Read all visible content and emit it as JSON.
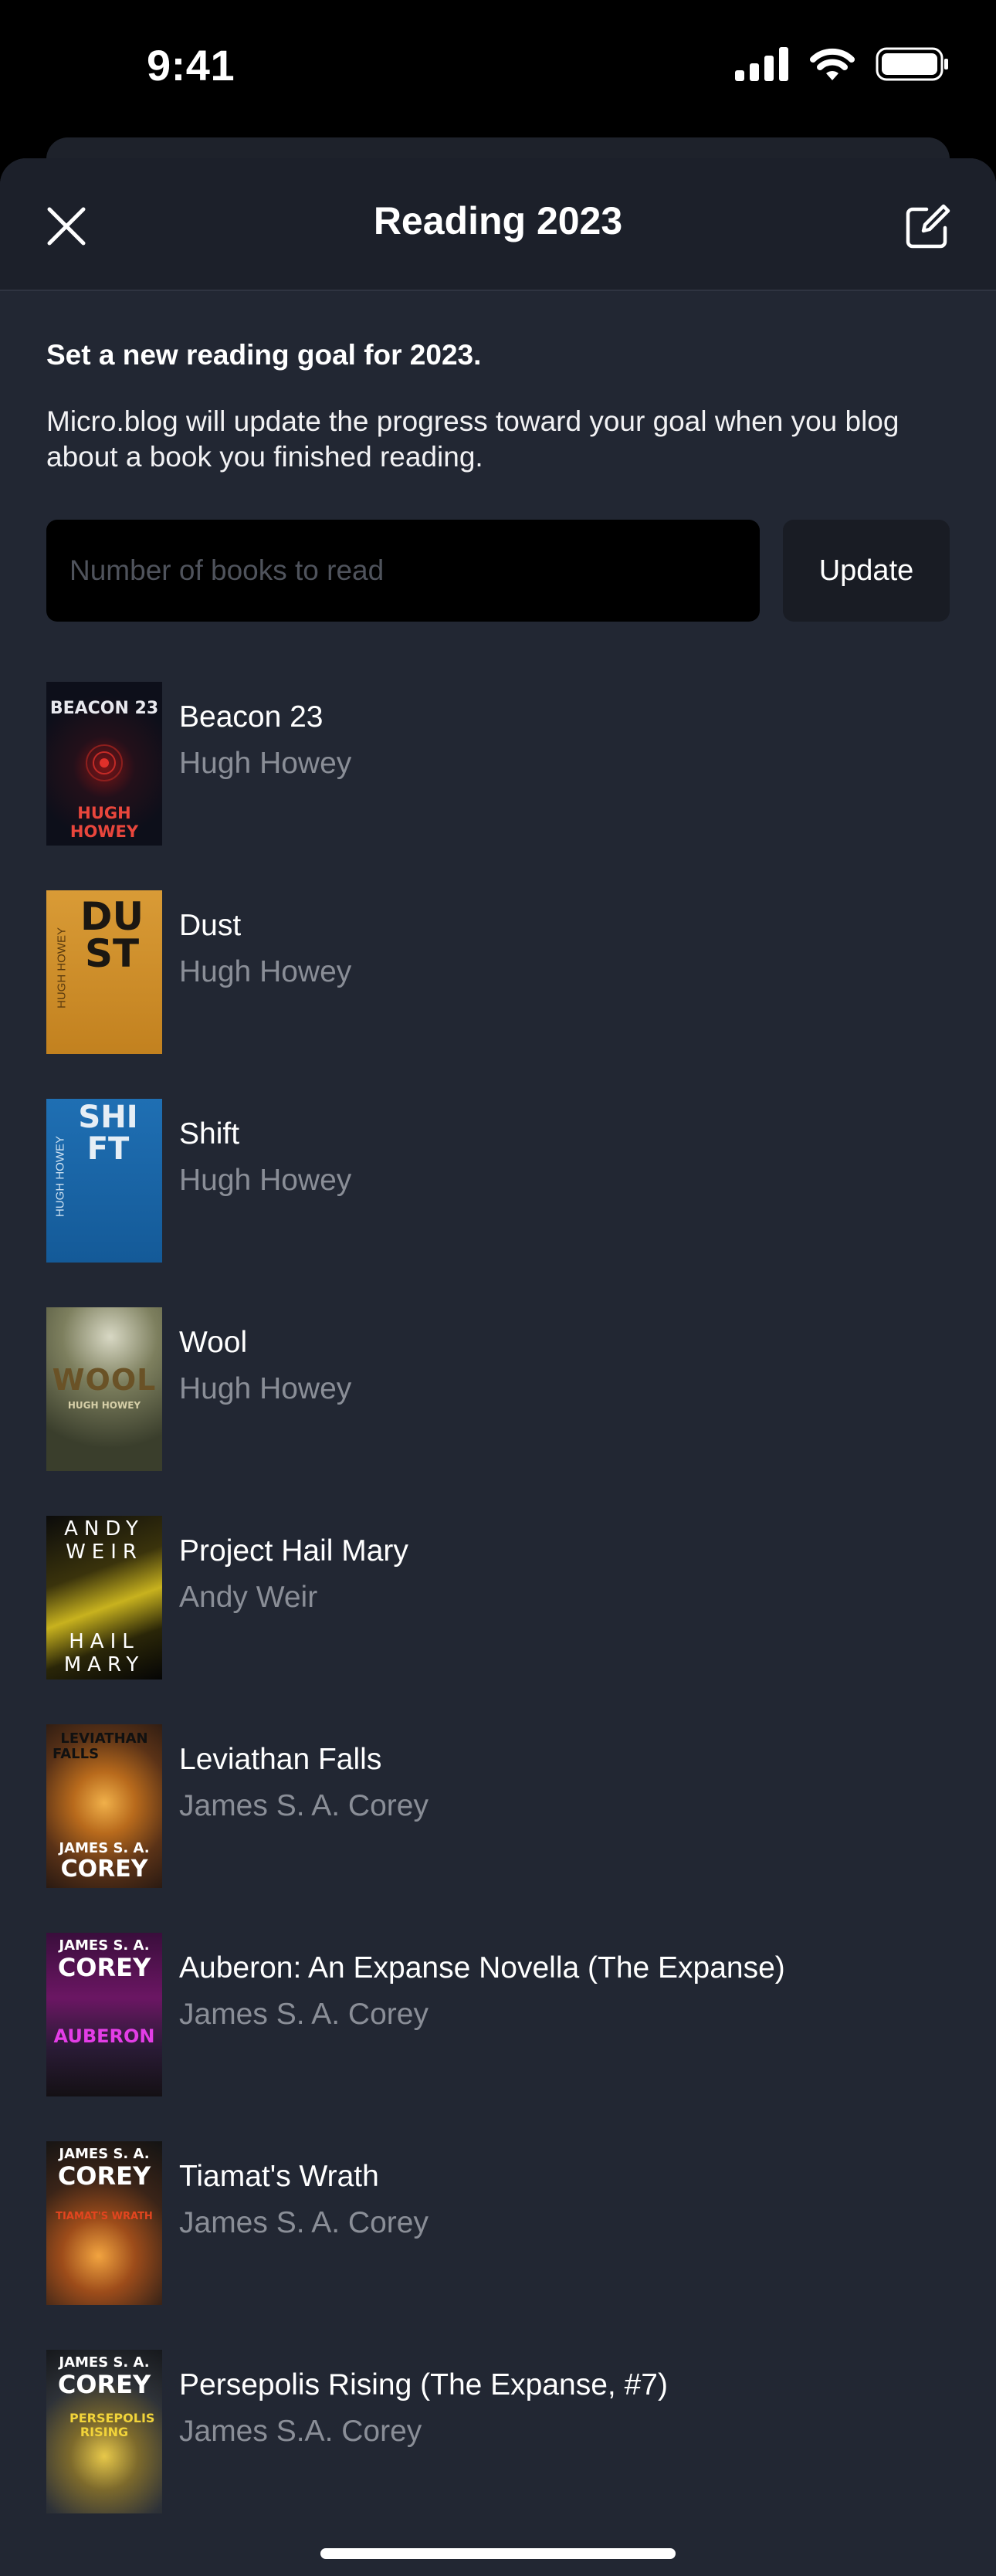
{
  "status": {
    "time": "9:41"
  },
  "nav": {
    "title": "Reading 2023"
  },
  "goal": {
    "heading": "Set a new reading goal for 2023.",
    "description": "Micro.blog will update the progress toward your goal when you blog about a book you finished reading.",
    "input_placeholder": "Number of books to read",
    "input_value": "",
    "update_label": "Update"
  },
  "books": [
    {
      "title": "Beacon 23",
      "author": "Hugh Howey",
      "cover_text": [
        "BEACON 23",
        "HUGH HOWEY"
      ]
    },
    {
      "title": "Dust",
      "author": "Hugh Howey",
      "cover_text": [
        "DUST",
        "HUGH HOWEY"
      ]
    },
    {
      "title": "Shift",
      "author": "Hugh Howey",
      "cover_text": [
        "SHIFT",
        "HUGH HOWEY"
      ]
    },
    {
      "title": "Wool",
      "author": "Hugh Howey",
      "cover_text": [
        "WOOL",
        "HUGH HOWEY"
      ]
    },
    {
      "title": "Project Hail Mary",
      "author": "Andy Weir",
      "cover_text": [
        "ANDY",
        "WEIR",
        "HAIL",
        "MARY"
      ]
    },
    {
      "title": "Leviathan Falls",
      "author": "James S. A. Corey",
      "cover_text": [
        "LEVIATHAN",
        "FALLS",
        "JAMES S. A.",
        "COREY"
      ]
    },
    {
      "title": "Auberon: An Expanse Novella (The Expanse)",
      "author": "James S. A. Corey",
      "cover_text": [
        "JAMES S. A.",
        "COREY",
        "AUBERON"
      ]
    },
    {
      "title": "Tiamat's Wrath",
      "author": "James S. A. Corey",
      "cover_text": [
        "JAMES S. A.",
        "COREY",
        "TIAMAT'S WRATH"
      ]
    },
    {
      "title": "Persepolis Rising (The Expanse, #7)",
      "author": "James S.A. Corey",
      "cover_text": [
        "JAMES S. A.",
        "COREY",
        "PERSEPOLIS RISING"
      ]
    }
  ],
  "colors": {
    "sheet_bg": "#222733",
    "nav_bg": "#1c202a",
    "author_text": "#8a8e97",
    "input_bg": "#000000",
    "button_bg": "#191c24"
  },
  "icons": [
    "signal-icon",
    "wifi-icon",
    "battery-icon",
    "close-icon",
    "compose-icon"
  ]
}
